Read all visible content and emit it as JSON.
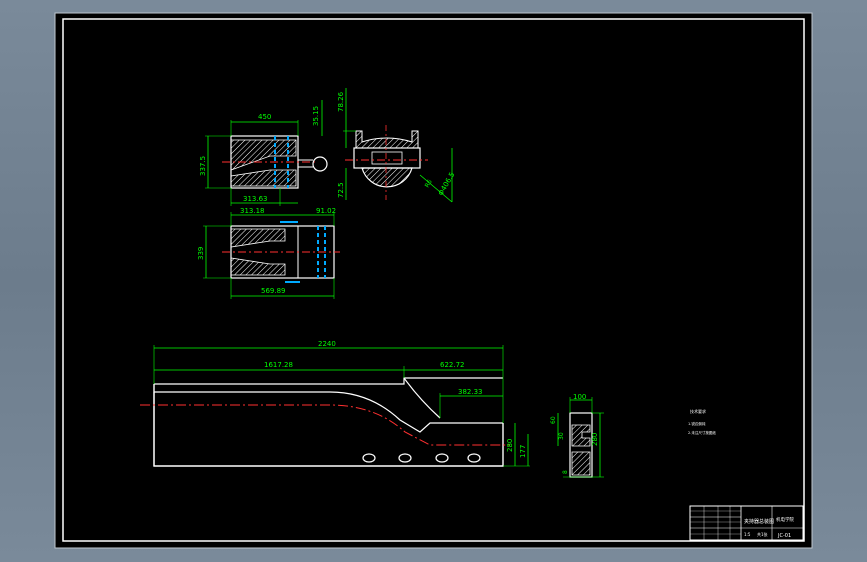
{
  "colors": {
    "background": "#000000",
    "outline": "#ffffff",
    "dimension": "#00ff00",
    "centerline": "#ff3030",
    "hidden": "#00aaff",
    "viewport": "#73838f"
  },
  "views": {
    "front": {
      "width": "450",
      "height": "337.5",
      "top_offset": "35.15",
      "bottom_a": "313.63"
    },
    "side": {
      "top": "78.26",
      "bottom": "72.5",
      "dia": "Φ406.5",
      "angle": "R6"
    },
    "bottom": {
      "a": "313.18",
      "b": "91.02",
      "height": "339",
      "length": "569.89"
    }
  },
  "main_view": {
    "overall": "2240",
    "left_part": "1617.28",
    "right_part": "622.72",
    "step": "382.33",
    "height_a": "280",
    "height_b": "177"
  },
  "section_view": {
    "top": "100",
    "left_a": "60",
    "left_b": "30",
    "right": "280",
    "bottom": "8"
  },
  "notes": {
    "title": "技术要求",
    "line1": "1.锐边倒钝",
    "line2": "2.未注尺寸按图纸"
  },
  "title_block": {
    "name": "夹持器总装图",
    "sub": "机电学院",
    "scale": "1:5",
    "sheet": "共1张",
    "drawing_no": "JC-01"
  }
}
